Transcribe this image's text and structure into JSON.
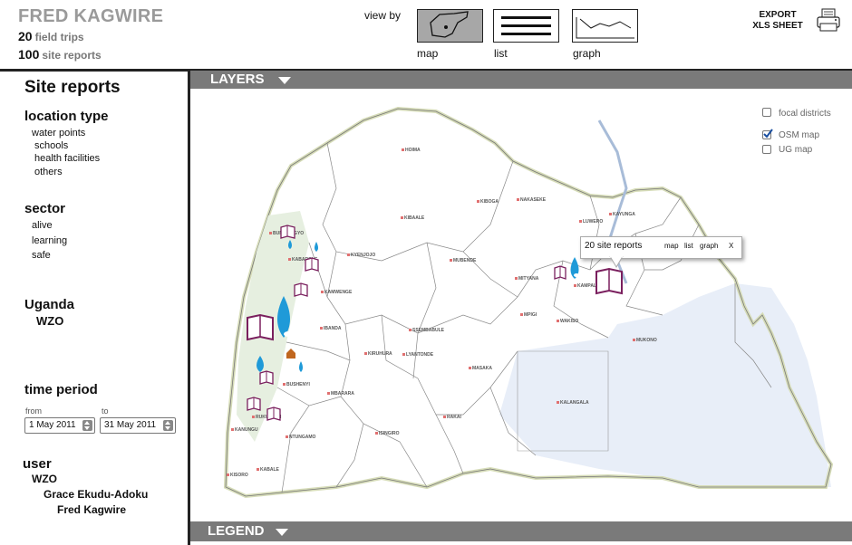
{
  "header": {
    "title": "FRED KAGWIRE",
    "stats": [
      {
        "count": "20",
        "label": "field trips"
      },
      {
        "count": "100",
        "label": "site reports"
      }
    ],
    "view_by_label": "view by",
    "views": [
      {
        "label": "map",
        "icon": "map-view-icon",
        "active": true
      },
      {
        "label": "list",
        "icon": "list-view-icon",
        "active": false
      },
      {
        "label": "graph",
        "icon": "graph-view-icon",
        "active": false
      }
    ],
    "export_line1": "EXPORT",
    "export_line2": "XLS SHEET"
  },
  "sidebar": {
    "title": "Site reports",
    "location_type": {
      "heading": "location type",
      "items": [
        "water points",
        "schools",
        "health facilities",
        "others"
      ]
    },
    "sector": {
      "heading": "sector",
      "items": [
        "alive",
        "learning",
        "safe"
      ]
    },
    "region": {
      "heading": "Uganda",
      "value": "WZO"
    },
    "time_period": {
      "heading": "time period",
      "from_label": "from",
      "to_label": "to",
      "from_value": "1 May 2011",
      "to_value": "31 May 2011"
    },
    "user": {
      "heading": "user",
      "org": "WZO",
      "people": [
        "Grace Ekudu-Adoku",
        "Fred Kagwire"
      ]
    }
  },
  "layers_bar": {
    "label": "LAYERS"
  },
  "legend_bar": {
    "label": "LEGEND"
  },
  "map": {
    "options": [
      {
        "label": "focal districts",
        "checked": false
      },
      {
        "label": "OSM map",
        "checked": true
      },
      {
        "label": "UG map",
        "checked": false
      }
    ],
    "popup": {
      "text": "20 site reports",
      "links": [
        "map",
        "list",
        "graph"
      ],
      "close": "X"
    },
    "districts": [
      "HOIMA",
      "KIBOGA",
      "NAKASEKE",
      "KAYUNGA",
      "LUWERO",
      "KIBAALE",
      "BUNDIBUGYO",
      "KABAROLE",
      "KYENJOJO",
      "MUBENDE",
      "MITYANA",
      "KAMPALA",
      "MPIGI",
      "WAKISO",
      "MUKONO",
      "KAMWENGE",
      "IBANDA",
      "SSEMBABULE",
      "KIRUHURA",
      "LYANTONDE",
      "MASAKA",
      "BUSHENYI",
      "MBARARA",
      "RAKAI",
      "KALANGALA",
      "RUKUNGIRI",
      "KANUNGU",
      "NTUNGAMO",
      "ISINGIRO",
      "KABALE",
      "KISORO"
    ],
    "colors": {
      "water": "#1f9ad8",
      "book": "#7a1f5e",
      "house": "#c0661e",
      "dot": "#e07070"
    }
  }
}
